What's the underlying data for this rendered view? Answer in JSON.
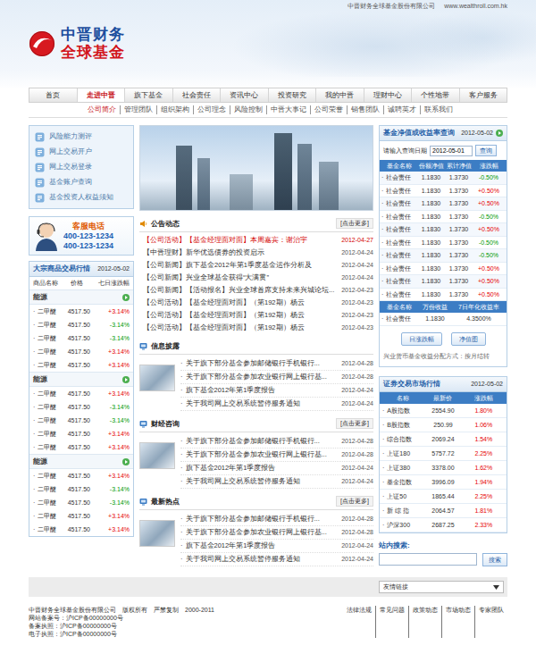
{
  "topbar": {
    "company": "中晋财务全球基金股份有限公司",
    "url": "www.wealthroll.com.hk"
  },
  "logo": {
    "line1": "中晋财务",
    "line2": "全球基金"
  },
  "bullet": "·",
  "nav": [
    {
      "label": "首页",
      "selected": false
    },
    {
      "label": "走进中晋",
      "selected": true
    },
    {
      "label": "旗下基金",
      "selected": false
    },
    {
      "label": "社会责任",
      "selected": false
    },
    {
      "label": "资讯中心",
      "selected": false
    },
    {
      "label": "投资研究",
      "selected": false
    },
    {
      "label": "我的中晋",
      "selected": false
    },
    {
      "label": "理财中心",
      "selected": false
    },
    {
      "label": "个性地带",
      "selected": false
    },
    {
      "label": "客户服务",
      "selected": false
    }
  ],
  "subnav": [
    {
      "label": "公司简介",
      "selected": true
    },
    {
      "label": "管理团队",
      "selected": false
    },
    {
      "label": "组织架构",
      "selected": false
    },
    {
      "label": "公司理念",
      "selected": false
    },
    {
      "label": "风险控制",
      "selected": false
    },
    {
      "label": "中晋大事记",
      "selected": false
    },
    {
      "label": "公司荣誉",
      "selected": false
    },
    {
      "label": "销售团队",
      "selected": false
    },
    {
      "label": "诚聘英才",
      "selected": false
    },
    {
      "label": "联系我们",
      "selected": false
    }
  ],
  "quick_links": [
    "风险能力测评",
    "网上交易开户",
    "网上交易登录",
    "基金账户查询",
    "基金投资人权益须知"
  ],
  "hotline": {
    "title": "客服电话",
    "numbers": [
      "400-123-1234",
      "400-123-1234"
    ]
  },
  "commodities": {
    "title": "大宗商品交易行情",
    "date": "2012-05-02",
    "columns": [
      "商品名称",
      "价格",
      "七日涨跌幅"
    ],
    "groups": [
      {
        "name": "能源",
        "rows": [
          {
            "name": "二甲醚",
            "price": "4517.50",
            "change": "+3.14%",
            "color": "#e60000"
          },
          {
            "name": "二甲醚",
            "price": "4517.50",
            "change": "-3.14%",
            "color": "#009900"
          },
          {
            "name": "二甲醚",
            "price": "4517.50",
            "change": "-3.14%",
            "color": "#009900"
          },
          {
            "name": "二甲醚",
            "price": "4517.50",
            "change": "+3.14%",
            "color": "#e60000"
          },
          {
            "name": "二甲醚",
            "price": "4517.50",
            "change": "+3.14%",
            "color": "#e60000"
          }
        ]
      },
      {
        "name": "能源",
        "rows": [
          {
            "name": "二甲醚",
            "price": "4517.50",
            "change": "+3.14%",
            "color": "#e60000"
          },
          {
            "name": "二甲醚",
            "price": "4517.50",
            "change": "-3.14%",
            "color": "#009900"
          },
          {
            "name": "二甲醚",
            "price": "4517.50",
            "change": "-3.14%",
            "color": "#009900"
          },
          {
            "name": "二甲醚",
            "price": "4517.50",
            "change": "+3.14%",
            "color": "#e60000"
          },
          {
            "name": "二甲醚",
            "price": "4517.50",
            "change": "+3.14%",
            "color": "#e60000"
          }
        ]
      },
      {
        "name": "能源",
        "rows": [
          {
            "name": "二甲醚",
            "price": "4517.50",
            "change": "+3.14%",
            "color": "#e60000"
          },
          {
            "name": "二甲醚",
            "price": "4517.50",
            "change": "-3.14%",
            "color": "#009900"
          },
          {
            "name": "二甲醚",
            "price": "4517.50",
            "change": "-3.14%",
            "color": "#009900"
          },
          {
            "name": "二甲醚",
            "price": "4517.50",
            "change": "+3.14%",
            "color": "#e60000"
          },
          {
            "name": "二甲醚",
            "price": "4517.50",
            "change": "+3.14%",
            "color": "#e60000"
          }
        ]
      }
    ]
  },
  "notices": {
    "title": "公告动态",
    "more": "[点击更多]",
    "items": [
      {
        "tag": "【公司活动】",
        "title": "【基金经理面对面】本周嘉宾：谢治宇",
        "date": "2012-04-27",
        "highlight": true
      },
      {
        "tag": "【中晋理财】",
        "title": "新华优选债券的投资启示",
        "date": "2012-04-24",
        "highlight": false
      },
      {
        "tag": "【公司新闻】",
        "title": "旗下基金2012年第1季度基金运作分析及",
        "date": "2012-04-24",
        "highlight": false
      },
      {
        "tag": "【公司新闻】",
        "title": "兴业全球基金获得“大满贯”",
        "date": "2012-04-24",
        "highlight": false
      },
      {
        "tag": "【公司新闻】",
        "title": "【活动报名】兴业全球首席支持未来兴城论坛...",
        "date": "2012-04-23",
        "highlight": false
      },
      {
        "tag": "【公司活动】",
        "title": "【基金经理面对面】（第192期）杨云",
        "date": "2012-04-23",
        "highlight": false
      },
      {
        "tag": "【公司活动】",
        "title": "【基金经理面对面】（第192期）杨云",
        "date": "2012-04-23",
        "highlight": false
      },
      {
        "tag": "【公司活动】",
        "title": "【基金经理面对面】（第192期）杨云",
        "date": "2012-04-23",
        "highlight": false
      }
    ]
  },
  "sections": [
    {
      "title": "信息披露",
      "items": [
        {
          "title": "关于旗下部分基金参加邮储银行手机银行...",
          "date": "2012-04-28"
        },
        {
          "title": "关于旗下部分基金参加农业银行网上银行基...",
          "date": "2012-04-28"
        },
        {
          "title": "旗下基金2012年第1季度报告",
          "date": "2012-04-24"
        },
        {
          "title": "关于我司网上交易系统暂停服务通知",
          "date": "2012-04-24"
        }
      ]
    },
    {
      "title": "财经咨询",
      "more": "[点击更多]",
      "items": [
        {
          "title": "关于旗下部分基金参加邮储银行手机银行...",
          "date": "2012-04-28"
        },
        {
          "title": "关于旗下部分基金参加农业银行网上银行基...",
          "date": "2012-04-28"
        },
        {
          "title": "旗下基金2012年第1季度报告",
          "date": "2012-04-24"
        },
        {
          "title": "关于我司网上交易系统暂停服务通知",
          "date": "2012-04-24"
        }
      ]
    },
    {
      "title": "最新热点",
      "more": "[点击更多]",
      "items": [
        {
          "title": "关于旗下部分基金参加邮储银行手机银行...",
          "date": "2012-04-28"
        },
        {
          "title": "关于旗下部分基金参加农业银行网上银行基...",
          "date": "2012-04-28"
        },
        {
          "title": "旗下基金2012年第1季度报告",
          "date": "2012-04-24"
        },
        {
          "title": "关于我司网上交易系统暂停服务通知",
          "date": "2012-04-24"
        }
      ]
    }
  ],
  "fund_query": {
    "title": "基金净值或收益率查询",
    "date": "2012-05-02",
    "prompt": "请输入查询日期",
    "input": "2012-05-01",
    "button": "查询",
    "columns": [
      "基金名称",
      "份额净值",
      "累计净值",
      "涨跌幅"
    ],
    "rows": [
      {
        "name": "社会责任",
        "nav": "1.1830",
        "acc": "1.3730",
        "change": "-0.50%",
        "color": "#009900"
      },
      {
        "name": "社会责任",
        "nav": "1.1830",
        "acc": "1.3730",
        "change": "+0.50%",
        "color": "#e60000"
      },
      {
        "name": "社会责任",
        "nav": "1.1830",
        "acc": "1.3730",
        "change": "+0.50%",
        "color": "#e60000"
      },
      {
        "name": "社会责任",
        "nav": "1.1830",
        "acc": "1.3730",
        "change": "-0.50%",
        "color": "#009900"
      },
      {
        "name": "社会责任",
        "nav": "1.1830",
        "acc": "1.3730",
        "change": "+0.50%",
        "color": "#e60000"
      },
      {
        "name": "社会责任",
        "nav": "1.1830",
        "acc": "1.3730",
        "change": "-0.50%",
        "color": "#009900"
      },
      {
        "name": "社会责任",
        "nav": "1.1830",
        "acc": "1.3730",
        "change": "-0.50%",
        "color": "#009900"
      },
      {
        "name": "社会责任",
        "nav": "1.1830",
        "acc": "1.3730",
        "change": "+0.50%",
        "color": "#e60000"
      },
      {
        "name": "社会责任",
        "nav": "1.1830",
        "acc": "1.3730",
        "change": "+0.50%",
        "color": "#e60000"
      },
      {
        "name": "社会责任",
        "nav": "1.1830",
        "acc": "1.3730",
        "change": "+0.50%",
        "color": "#e60000"
      }
    ],
    "columns2": [
      "基金名称",
      "万份收益",
      "7日年化收益率"
    ],
    "rows2": [
      {
        "name": "社会责任",
        "yield": "1.1830",
        "rate": "4.3500%"
      }
    ],
    "buttons": [
      "日涨跌幅",
      "净值图"
    ],
    "note": "兴业货币基金收益分配方式：按月结转"
  },
  "market": {
    "title": "证券交易市场行情",
    "date": "2012-05-02",
    "columns": [
      "名称",
      "最新价",
      "涨跌幅"
    ],
    "rows": [
      {
        "name": "A股指数",
        "price": "2554.90",
        "change": "1.80%",
        "color": "#e60000"
      },
      {
        "name": "B股指数",
        "price": "250.99",
        "change": "1.06%",
        "color": "#e60000"
      },
      {
        "name": "综合指数",
        "price": "2069.24",
        "change": "1.54%",
        "color": "#e60000"
      },
      {
        "name": "上证180",
        "price": "5757.72",
        "change": "2.25%",
        "color": "#e60000"
      },
      {
        "name": "上证380",
        "price": "3378.00",
        "change": "1.62%",
        "color": "#e60000"
      },
      {
        "name": "基金指数",
        "price": "3996.09",
        "change": "1.94%",
        "color": "#e60000"
      },
      {
        "name": "上证50",
        "price": "1865.44",
        "change": "2.25%",
        "color": "#e60000"
      },
      {
        "name": "新 综 指",
        "price": "2064.57",
        "change": "1.81%",
        "color": "#e60000"
      },
      {
        "name": "沪深300",
        "price": "2687.25",
        "change": "2.33%",
        "color": "#e60000"
      }
    ]
  },
  "search": {
    "title": "站内搜索:",
    "button": "搜索"
  },
  "links_bar": {
    "label": "友情链接"
  },
  "footer": {
    "copyright": "中晋财务全球基金股份有限公司　版权所有　严禁复制　2000-2011",
    "links": [
      "法律法规",
      "常见问题",
      "政策动态",
      "市场动态",
      "专家团队"
    ],
    "records": [
      "网站备案号：沪ICP备00000000号",
      "备案执照：沪ICP备00000000号",
      "电子执照：沪ICP备00000000号"
    ]
  }
}
